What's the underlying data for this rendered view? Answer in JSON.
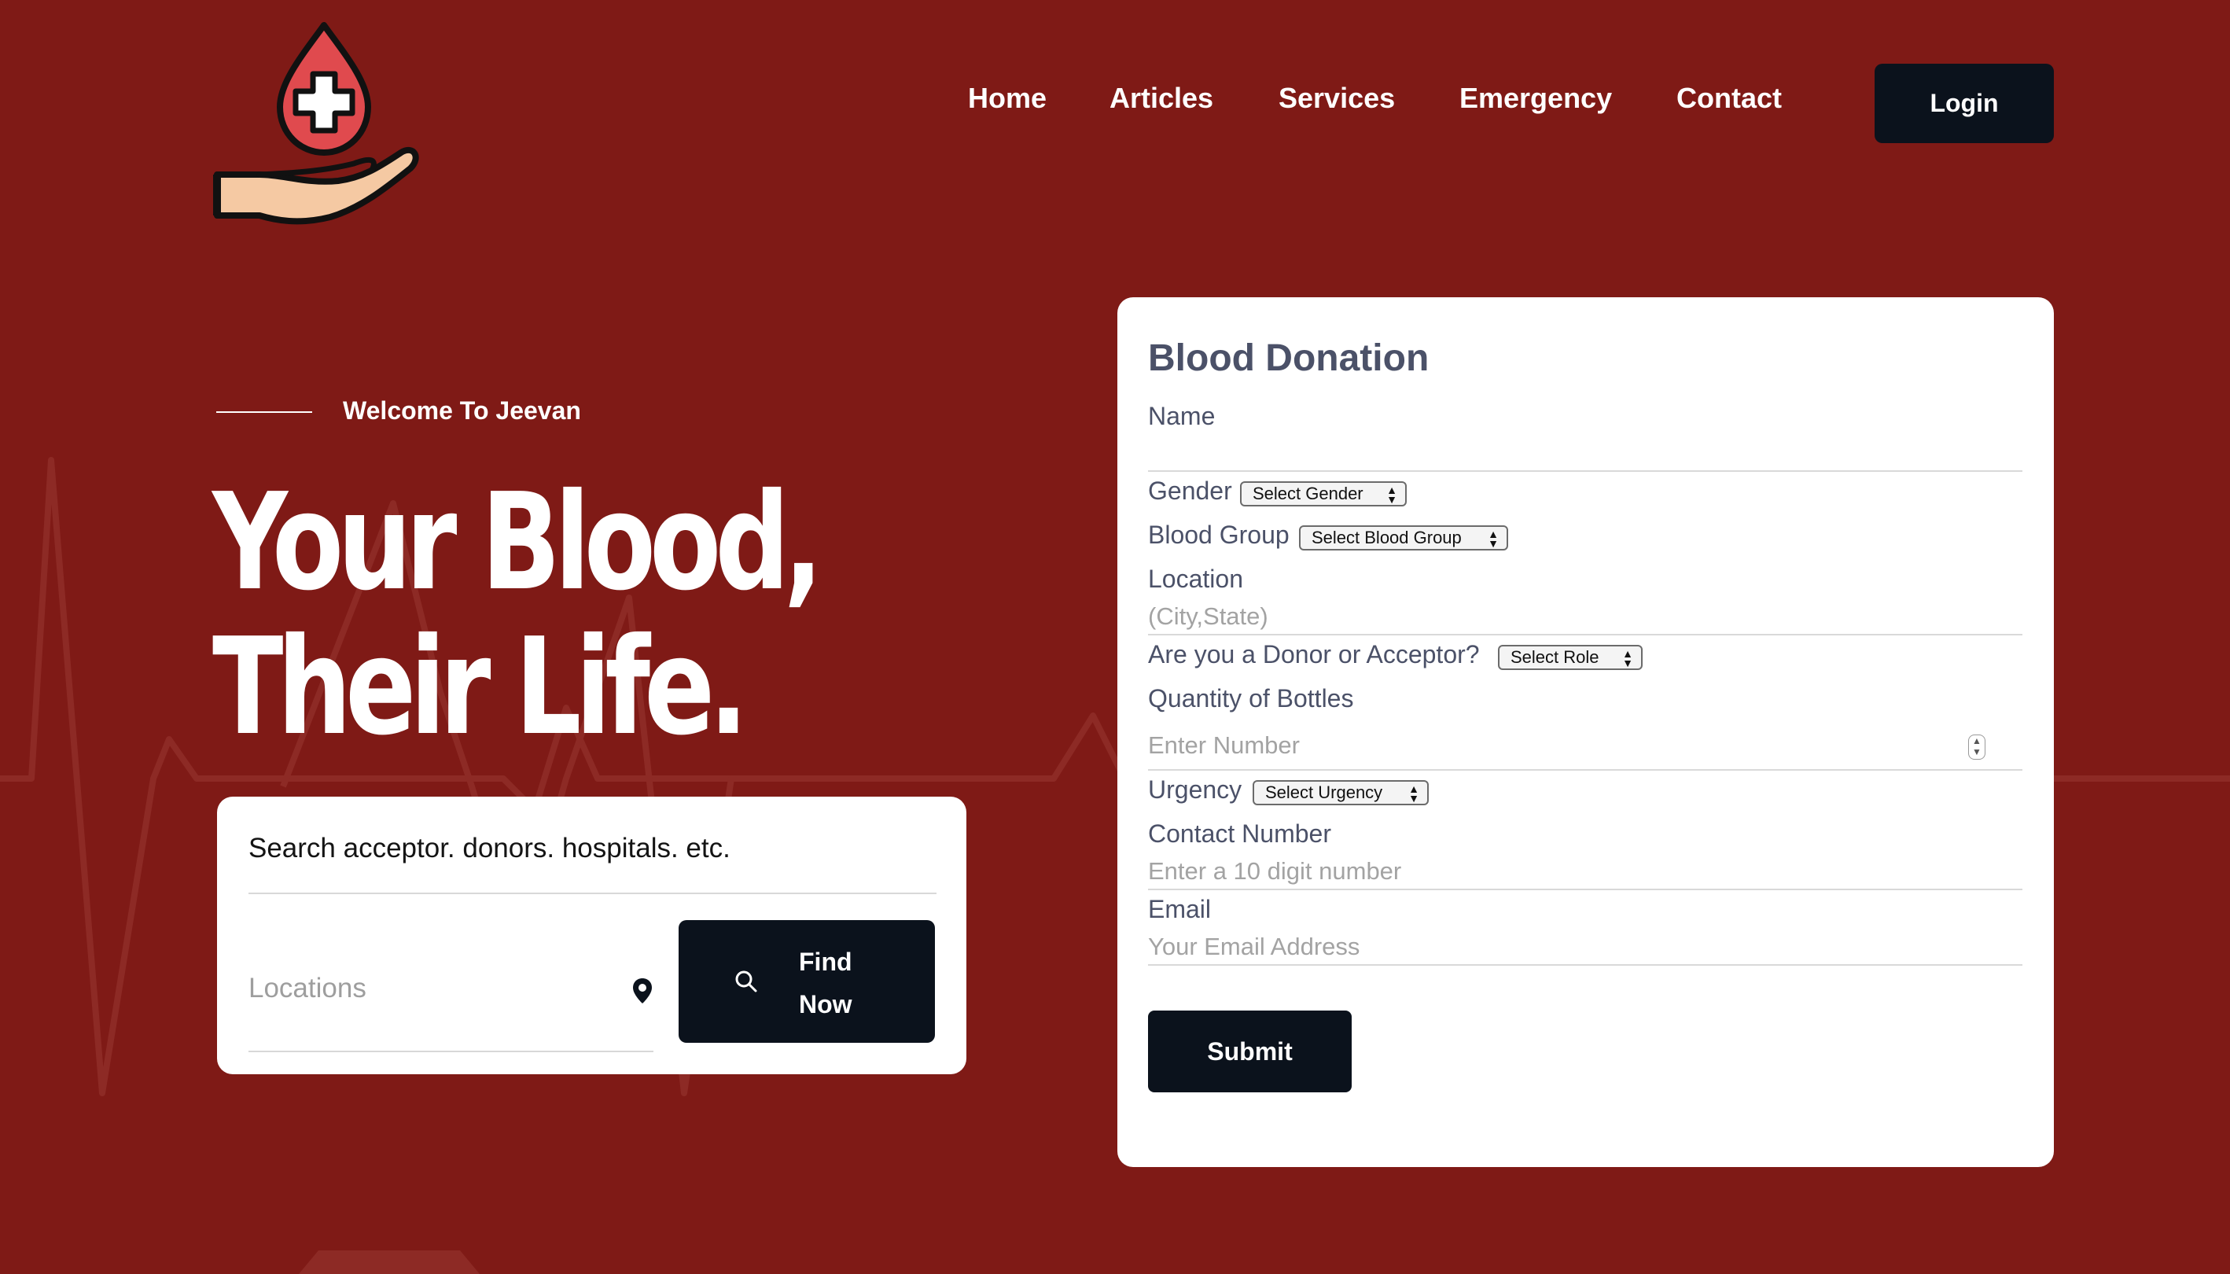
{
  "brand": {
    "logo_icon": "blood-drop-hand-icon"
  },
  "nav": {
    "items": [
      {
        "label": "Home"
      },
      {
        "label": "Articles"
      },
      {
        "label": "Services"
      },
      {
        "label": "Emergency"
      },
      {
        "label": "Contact"
      }
    ],
    "login_label": "Login"
  },
  "hero": {
    "welcome": "Welcome To Jeevan",
    "headline_line1": "Your Blood,",
    "headline_line2": "Their Life."
  },
  "search": {
    "query_text": "Search acceptor. donors. hospitals. etc.",
    "location_placeholder": "Locations",
    "location_icon": "map-pin-icon",
    "search_icon": "search-icon",
    "find_label": "Find Now"
  },
  "form": {
    "title": "Blood Donation",
    "name_label": "Name",
    "gender_label": "Gender",
    "gender_select": "Select Gender",
    "blood_group_label": "Blood Group",
    "blood_group_select": "Select Blood Group",
    "location_label": "Location",
    "location_placeholder": "(City,State)",
    "role_label": "Are you a Donor or Acceptor?",
    "role_select": "Select Role",
    "quantity_label": "Quantity of Bottles",
    "quantity_placeholder": "Enter Number",
    "urgency_label": "Urgency",
    "urgency_select": "Select Urgency",
    "contact_label": "Contact Number",
    "contact_placeholder": "Enter a 10 digit number",
    "email_label": "Email",
    "email_placeholder": "Your Email Address",
    "submit_label": "Submit"
  },
  "colors": {
    "background": "#7f1a16",
    "button_dark": "#0b121c",
    "form_text": "#4b5168",
    "drop_red": "#e04a4e",
    "hand_skin": "#f5c9a3"
  }
}
